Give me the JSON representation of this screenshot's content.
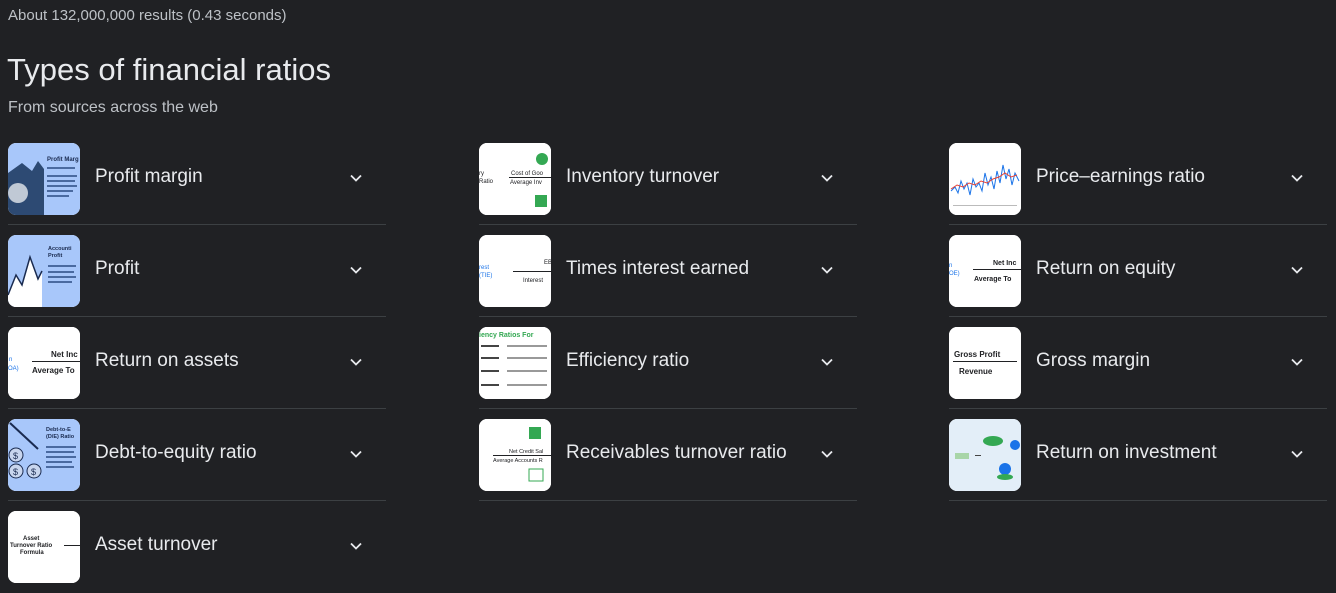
{
  "header": {
    "stats": "About 132,000,000 results (0.43 seconds)",
    "title": "Types of financial ratios",
    "subtitle": "From sources across the web"
  },
  "columns": [
    [
      {
        "label": "Profit margin",
        "thumb": "profit-margin-thumb",
        "thumb_text": [
          "Profit Marg"
        ]
      },
      {
        "label": "Profit",
        "thumb": "profit-thumb",
        "thumb_text": [
          "Accounti",
          "Profit"
        ]
      },
      {
        "label": "Return on assets",
        "thumb": "return-on-assets-thumb",
        "thumb_text": [
          "Net Inc",
          "Average To",
          "n",
          "OA)"
        ]
      },
      {
        "label": "Debt-to-equity ratio",
        "thumb": "debt-to-equity-thumb",
        "thumb_text": [
          "Debt-to-E",
          "(D/E) Ratio"
        ]
      },
      {
        "label": "Asset turnover",
        "thumb": "asset-turnover-thumb",
        "thumb_text": [
          "Asset",
          "Turnover Ratio",
          "Formula"
        ]
      }
    ],
    [
      {
        "label": "Inventory turnover",
        "thumb": "inventory-turnover-thumb",
        "thumb_text": [
          "ry",
          "Ratio",
          "Cost of Goo",
          "Average Inv"
        ]
      },
      {
        "label": "Times interest earned",
        "thumb": "times-interest-earned-thumb",
        "thumb_text": [
          "rest",
          "(TIE)",
          "Interest",
          "EB"
        ]
      },
      {
        "label": "Efficiency ratio",
        "thumb": "efficiency-ratio-thumb",
        "thumb_text": [
          "iency Ratios For"
        ]
      },
      {
        "label": "Receivables turnover ratio",
        "thumb": "receivables-turnover-thumb",
        "thumb_text": [
          "Net Credit Sal",
          "Average Accounts R"
        ]
      }
    ],
    [
      {
        "label": "Price–earnings ratio",
        "thumb": "price-earnings-thumb",
        "thumb_text": []
      },
      {
        "label": "Return on equity",
        "thumb": "return-on-equity-thumb",
        "thumb_text": [
          "n",
          "OE)",
          "Net Inc",
          "Average To"
        ]
      },
      {
        "label": "Gross margin",
        "thumb": "gross-margin-thumb",
        "thumb_text": [
          "Gross Profit",
          "Revenue"
        ]
      },
      {
        "label": "Return on investment",
        "thumb": "return-on-investment-thumb",
        "thumb_text": []
      }
    ]
  ],
  "colors": {
    "background": "#202124",
    "text": "#e8eaed",
    "secondary": "#bdc1c6",
    "divider": "#3c4043",
    "thumb_blue": "#a8c7fa"
  },
  "icons": {
    "expand": "chevron-down-icon"
  }
}
